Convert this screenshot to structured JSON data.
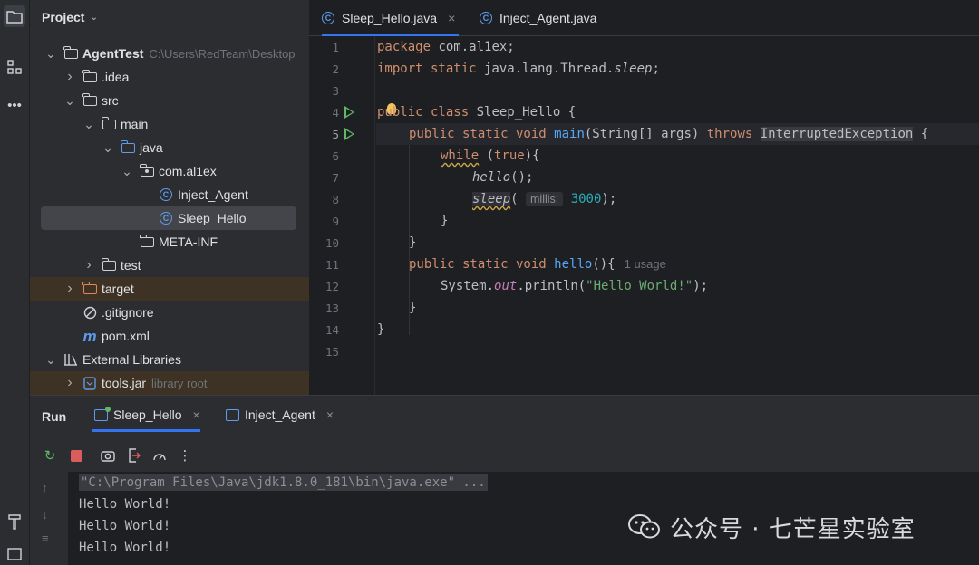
{
  "project": {
    "title": "Project",
    "tree": [
      {
        "label": "AgentTest",
        "extra": "C:\\Users\\RedTeam\\Desktop",
        "arrow": "v",
        "icon": "module-folder-icon",
        "depth": 0
      },
      {
        "label": ".idea",
        "arrow": ">",
        "icon": "folder-icon",
        "depth": 1
      },
      {
        "label": "src",
        "arrow": "v",
        "icon": "folder-icon",
        "depth": 1
      },
      {
        "label": "main",
        "arrow": "v",
        "icon": "folder-icon",
        "depth": 2
      },
      {
        "label": "java",
        "arrow": "v",
        "icon": "source-folder-icon",
        "depth": 3
      },
      {
        "label": "com.al1ex",
        "arrow": "v",
        "icon": "package-icon",
        "depth": 4
      },
      {
        "label": "Inject_Agent",
        "arrow": "",
        "icon": "java-class-icon",
        "depth": 5
      },
      {
        "label": "Sleep_Hello",
        "arrow": "",
        "icon": "java-class-icon",
        "depth": 5,
        "selected": true
      },
      {
        "label": "META-INF",
        "arrow": "",
        "icon": "folder-icon",
        "depth": 4
      },
      {
        "label": "test",
        "arrow": ">",
        "icon": "folder-icon",
        "depth": 2
      },
      {
        "label": "target",
        "arrow": ">",
        "icon": "excluded-folder-icon",
        "depth": 1,
        "excluded": true
      },
      {
        "label": ".gitignore",
        "arrow": "",
        "icon": "ignore-file-icon",
        "depth": 1
      },
      {
        "label": "pom.xml",
        "arrow": "",
        "icon": "maven-icon",
        "depth": 1
      },
      {
        "label": "External Libraries",
        "arrow": "v",
        "icon": "libraries-icon",
        "depth": 0
      },
      {
        "label": "tools.jar",
        "extra": "library root",
        "arrow": ">",
        "icon": "jar-icon",
        "depth": 1,
        "excluded": true
      }
    ]
  },
  "editor": {
    "tabs": [
      {
        "label": "Sleep_Hello.java",
        "close": "×",
        "active": true
      },
      {
        "label": "Inject_Agent.java",
        "close": "",
        "active": false
      }
    ],
    "line_numbers": [
      "1",
      "2",
      "3",
      "4",
      "5",
      "6",
      "7",
      "8",
      "9",
      "10",
      "11",
      "12",
      "13",
      "14",
      "15"
    ],
    "code": {
      "l1_kw": "package",
      "l1_rest": " com.al1ex;",
      "l2_kw": "import static",
      "l2_rest": " java.lang.Thread.",
      "l2_it": "sleep",
      "l2_end": ";",
      "l4_kw": "public class",
      "l4_rest": " Sleep_Hello {",
      "l5_kw": "public static void",
      "l5_fn": "main",
      "l5_args": "(String[] args) ",
      "l5_throws": "throws",
      "l5_exc": "InterruptedException",
      "l5_end": " {",
      "l6_kw": "while",
      "l6_rest": " (",
      "l6_true": "true",
      "l6_end": "){",
      "l7_it": "hello",
      "l7_end": "();",
      "l8_it": "sleep",
      "l8_open": "( ",
      "l8_hint": "millis:",
      "l8_num": "3000",
      "l8_end": ");",
      "l9": "}",
      "l10": "}",
      "l11_kw": "public static void",
      "l11_fn": "hello",
      "l11_end": "(){",
      "l11_usage": "1 usage",
      "l12_a": "System.",
      "l12_out": "out",
      "l12_b": ".println(",
      "l12_str": "\"Hello World!\"",
      "l12_end": ");",
      "l13": "}",
      "l14": "}"
    }
  },
  "run": {
    "title": "Run",
    "tabs": [
      {
        "label": "Sleep_Hello",
        "close": "×"
      },
      {
        "label": "Inject_Agent",
        "close": "×"
      }
    ],
    "console": [
      "\"C:\\Program Files\\Java\\jdk1.8.0_181\\bin\\java.exe\" ...",
      "Hello World!",
      "Hello World!",
      "Hello World!"
    ]
  },
  "watermark": "公众号 · 七芒星实验室"
}
